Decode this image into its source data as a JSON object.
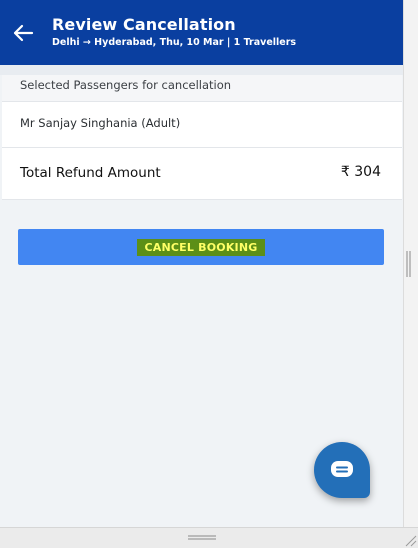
{
  "header": {
    "title": "Review Cancellation",
    "subtitle": "Delhi → Hyderabad, Thu, 10 Mar | 1 Travellers",
    "back_icon": "arrow-left-icon",
    "background": "#0a3fa0"
  },
  "section": {
    "label": "Selected Passengers for cancellation"
  },
  "passengers": [
    {
      "name": "Mr Sanjay Singhania (Adult)"
    }
  ],
  "refund": {
    "label": "Total Refund Amount",
    "amount": "₹ 304"
  },
  "cancel_button": {
    "label": "CANCEL BOOKING",
    "background": "#4286f2",
    "highlight": "#5c8f17",
    "text_color": "#ffff66"
  },
  "chat": {
    "icon": "chat-bubble-icon",
    "background": "#236fb8"
  }
}
